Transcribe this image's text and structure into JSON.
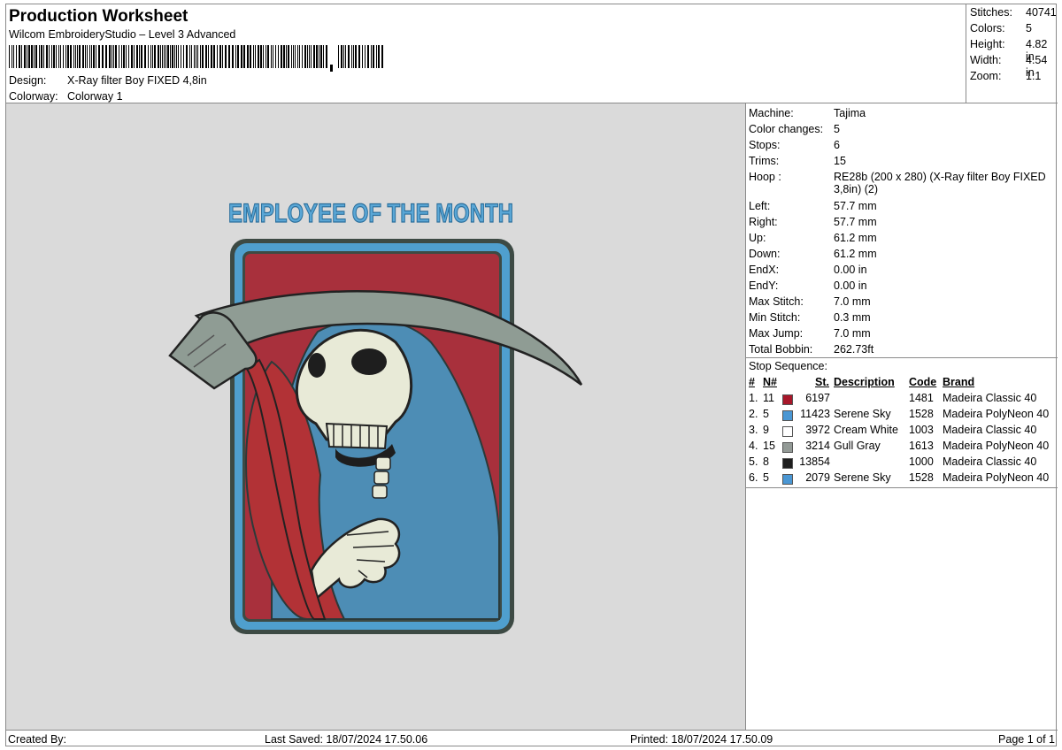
{
  "header": {
    "title": "Production Worksheet",
    "subtitle": "Wilcom EmbroideryStudio – Level 3 Advanced",
    "design_label": "Design:",
    "design_value": "X-Ray filter Boy FIXED 4,8in",
    "colorway_label": "Colorway:",
    "colorway_value": "Colorway 1"
  },
  "summary": [
    {
      "label": "Stitches:",
      "value": "40741"
    },
    {
      "label": "Colors:",
      "value": "5"
    },
    {
      "label": "Height:",
      "value": "4.82 in"
    },
    {
      "label": "Width:",
      "value": "4.54 in"
    },
    {
      "label": "Zoom:",
      "value": "1:1"
    }
  ],
  "preview": {
    "design_text": "EMPLOYEE OF THE MONTH"
  },
  "machine_info": [
    {
      "label": "Machine:",
      "value": "Tajima"
    },
    {
      "label": "Color changes:",
      "value": "5"
    },
    {
      "label": "Stops:",
      "value": "6"
    },
    {
      "label": "Trims:",
      "value": "15"
    },
    {
      "label": "Hoop :",
      "value": "RE28b (200 x 280) (X-Ray filter Boy FIXED 3,8in) (2)"
    },
    {
      "label": "Left:",
      "value": "57.7 mm"
    },
    {
      "label": "Right:",
      "value": "57.7 mm"
    },
    {
      "label": "Up:",
      "value": "61.2 mm"
    },
    {
      "label": "Down:",
      "value": "61.2 mm"
    },
    {
      "label": "EndX:",
      "value": "0.00 in"
    },
    {
      "label": "EndY:",
      "value": "0.00 in"
    },
    {
      "label": "Max Stitch:",
      "value": "7.0 mm"
    },
    {
      "label": "Min Stitch:",
      "value": "0.3 mm"
    },
    {
      "label": "Max Jump:",
      "value": "7.0 mm"
    },
    {
      "label": "Total Bobbin:",
      "value": "262.73ft"
    }
  ],
  "stop_sequence": {
    "title": "Stop Sequence:",
    "columns": {
      "idx": "#",
      "n": "N#",
      "st": "St.",
      "desc": "Description",
      "code": "Code",
      "brand": "Brand"
    },
    "rows": [
      {
        "idx": "1.",
        "n": "11",
        "color": "#a8172a",
        "st": "6197",
        "desc": "",
        "code": "1481",
        "brand": "Madeira Classic 40"
      },
      {
        "idx": "2.",
        "n": "5",
        "color": "#4a97d4",
        "st": "11423",
        "desc": "Serene Sky",
        "code": "1528",
        "brand": "Madeira PolyNeon 40"
      },
      {
        "idx": "3.",
        "n": "9",
        "color": "#ffffff",
        "st": "3972",
        "desc": "Cream White",
        "code": "1003",
        "brand": "Madeira Classic 40"
      },
      {
        "idx": "4.",
        "n": "15",
        "color": "#939a96",
        "st": "3214",
        "desc": "Gull Gray",
        "code": "1613",
        "brand": "Madeira PolyNeon 40"
      },
      {
        "idx": "5.",
        "n": "8",
        "color": "#1e1e1e",
        "st": "13854",
        "desc": "",
        "code": "1000",
        "brand": "Madeira Classic 40"
      },
      {
        "idx": "6.",
        "n": "5",
        "color": "#4a97d4",
        "st": "2079",
        "desc": "Serene Sky",
        "code": "1528",
        "brand": "Madeira PolyNeon 40"
      }
    ]
  },
  "footer": {
    "created_by": "Created By:",
    "last_saved": "Last Saved: 18/07/2024 17.50.06",
    "printed": "Printed: 18/07/2024 17.50.09",
    "page": "Page 1 of 1"
  }
}
